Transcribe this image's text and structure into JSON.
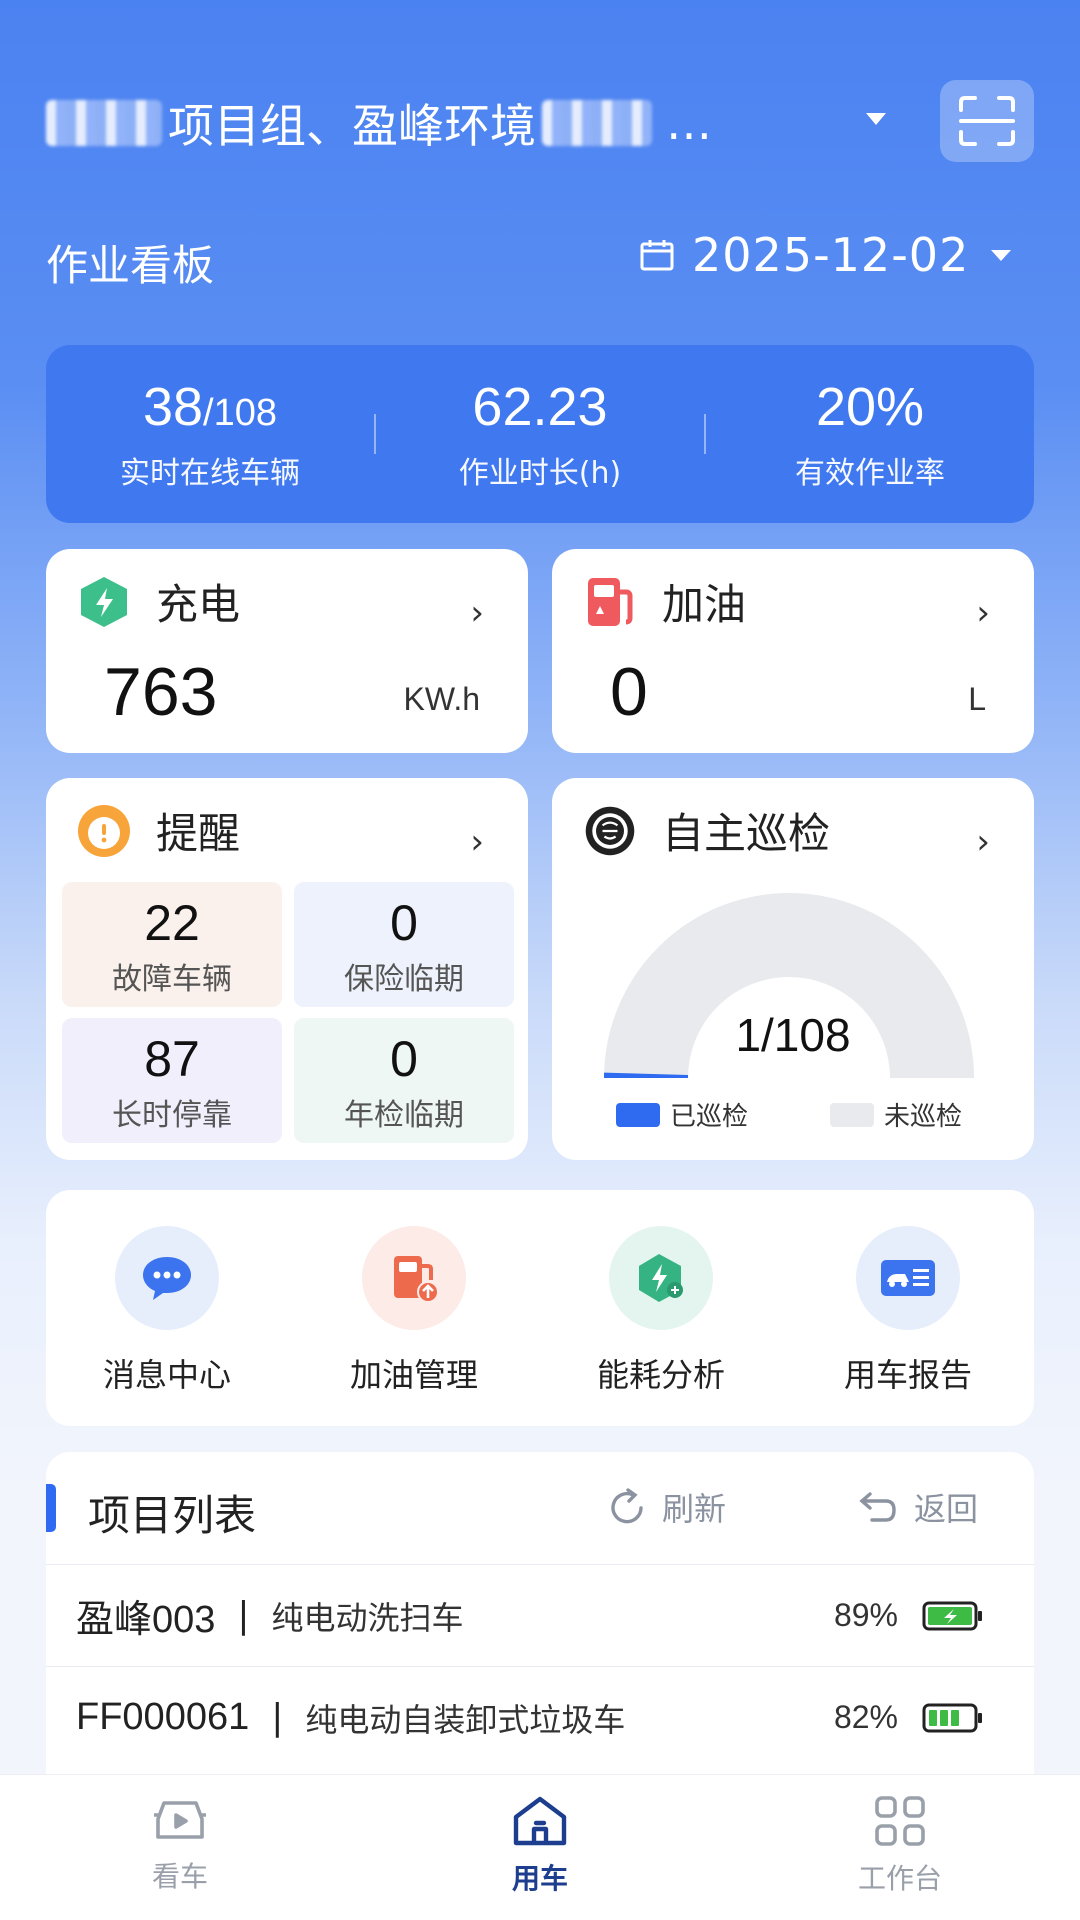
{
  "header": {
    "title": "项目组、盈峰环境",
    "ellipsis": "…"
  },
  "board": {
    "title": "作业看板",
    "date": "2025-12-02"
  },
  "stats": [
    {
      "value": "38",
      "total": "/108",
      "label": "实时在线车辆"
    },
    {
      "value": "62.23",
      "total": "",
      "label": "作业时长(h)"
    },
    {
      "value": "20%",
      "total": "",
      "label": "有效作业率"
    }
  ],
  "charge": {
    "title": "充电",
    "value": "763",
    "unit": "KW.h",
    "icon": "charging-shield-icon",
    "color": "#3cbf8a"
  },
  "fuel": {
    "title": "加油",
    "value": "0",
    "unit": "L",
    "icon": "fuel-pump-icon",
    "color": "#ef5a5f"
  },
  "alerts": {
    "title": "提醒",
    "icon": "warning-icon",
    "items": [
      {
        "value": "22",
        "label": "故障车辆",
        "bg": "#fbf1ec"
      },
      {
        "value": "0",
        "label": "保险临期",
        "bg": "#eef2fc"
      },
      {
        "value": "87",
        "label": "长时停靠",
        "bg": "#f1effb"
      },
      {
        "value": "0",
        "label": "年检临期",
        "bg": "#eef7f4"
      }
    ]
  },
  "patrol": {
    "title": "自主巡检",
    "icon": "patrol-icon",
    "done": 1,
    "total": 108,
    "display": "1/108",
    "legend_done": "已巡检",
    "legend_todo": "未巡检",
    "color_done": "#2f6bf0",
    "color_todo": "#e8eaee"
  },
  "chevron": "›",
  "quick_actions": [
    {
      "label": "消息中心",
      "icon": "message-bubble-icon",
      "bg": "#e6eefc"
    },
    {
      "label": "加油管理",
      "icon": "fuel-manage-icon",
      "bg": "#fcebe6"
    },
    {
      "label": "能耗分析",
      "icon": "energy-analysis-icon",
      "bg": "#e4f5ef"
    },
    {
      "label": "用车报告",
      "icon": "vehicle-report-icon",
      "bg": "#e6eefc"
    }
  ],
  "project_list": {
    "title": "项目列表",
    "refresh": "刷新",
    "back": "返回",
    "rows": [
      {
        "code": "盈峰003",
        "sep": "|",
        "type": "纯电动洗扫车",
        "battery": "89%",
        "charging": true
      },
      {
        "code": "FF000061",
        "sep": "|",
        "type": "纯电动自装卸式垃圾车",
        "battery": "82%",
        "charging": false
      }
    ]
  },
  "nav": [
    {
      "label": "看车",
      "icon": "car-view-icon",
      "active": false
    },
    {
      "label": "用车",
      "icon": "home-car-icon",
      "active": true
    },
    {
      "label": "工作台",
      "icon": "grid-workbench-icon",
      "active": false
    }
  ],
  "colors": {
    "accent": "#2f6bf0",
    "nav_active": "#1d3d8f",
    "nav_inactive": "#9aa0aa"
  }
}
